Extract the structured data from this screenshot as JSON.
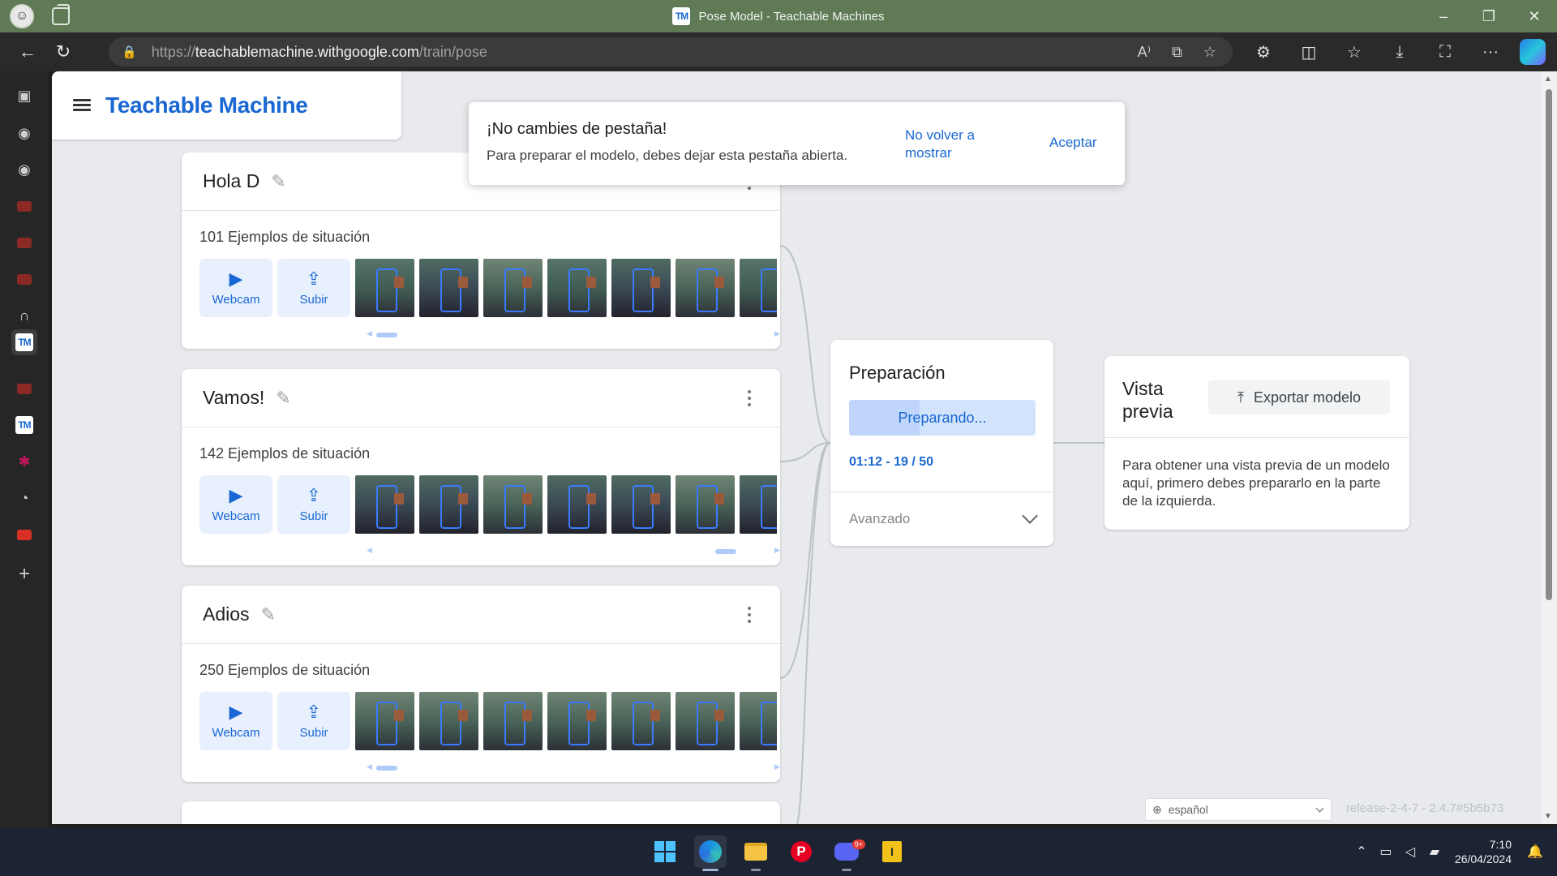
{
  "window": {
    "title": "Pose Model - Teachable Machines",
    "tab_logo": "TM",
    "controls": {
      "minimize": "–",
      "restore": "❐",
      "close": "✕"
    }
  },
  "address_bar": {
    "url_prefix": "https://",
    "url_host": "teachablemachine.withgoogle.com",
    "url_path": "/train/pose"
  },
  "sidebar_items": [
    {
      "name": "tab-actions-icon"
    },
    {
      "name": "github-icon"
    },
    {
      "name": "github-icon"
    },
    {
      "name": "youtube-icon"
    },
    {
      "name": "youtube-icon"
    },
    {
      "name": "youtube-icon"
    },
    {
      "name": "headphones-icon"
    },
    {
      "name": "teachable-machine-icon"
    },
    {
      "name": "youtube-icon"
    },
    {
      "name": "teachable-machine-icon"
    },
    {
      "name": "asterisk-icon"
    },
    {
      "name": "google-icon"
    },
    {
      "name": "youtube-icon"
    },
    {
      "name": "add-icon"
    }
  ],
  "app": {
    "brand": "Teachable Machine",
    "toast": {
      "title": "¡No cambies de pestaña!",
      "message": "Para preparar el modelo, debes dejar esta pestaña abierta.",
      "dont_show": "No volver a mostrar",
      "accept": "Aceptar"
    },
    "classes": [
      {
        "name": "Hola D",
        "examples": "101 Ejemplos de situación",
        "webcam": "Webcam",
        "upload": "Subir",
        "scroll_pos": 0.0
      },
      {
        "name": "Vamos!",
        "examples": "142 Ejemplos de situación",
        "webcam": "Webcam",
        "upload": "Subir",
        "scroll_pos": 0.92
      },
      {
        "name": "Adios",
        "examples": "250 Ejemplos de situación",
        "webcam": "Webcam",
        "upload": "Subir",
        "scroll_pos": 0.0
      }
    ],
    "training": {
      "title": "Preparación",
      "button": "Preparando...",
      "progress": "01:12 - 19 / 50",
      "progress_fraction": 0.38,
      "advanced": "Avanzado"
    },
    "preview": {
      "title": "Vista previa",
      "export": "Exportar modelo",
      "text": "Para obtener una vista previa de un modelo aquí, primero debes prepararlo en la parte de la izquierda."
    },
    "language": "español",
    "release": "release-2-4-7 - 2.4.7#5b5b73"
  },
  "taskbar": {
    "discord_badge": "9+",
    "time": "7:10",
    "date": "26/04/2024"
  },
  "colors": {
    "accent": "#1967d2",
    "titlebar": "#5f7a55",
    "canvas": "#e8eaed"
  }
}
